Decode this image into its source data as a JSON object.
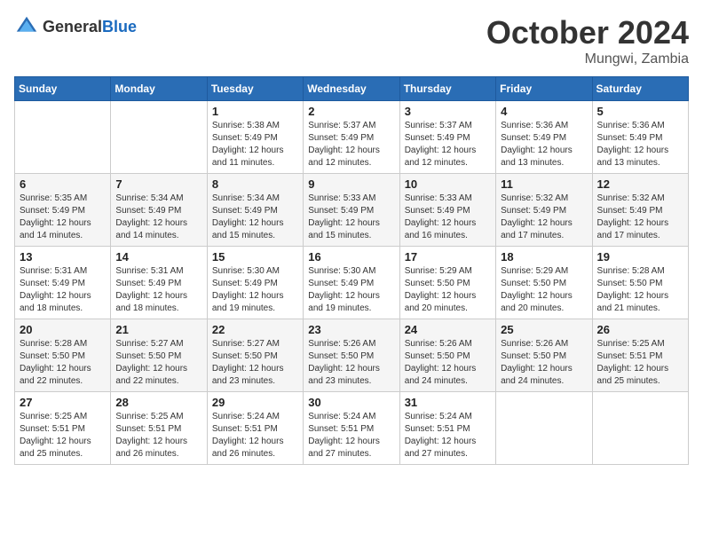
{
  "header": {
    "logo_general": "General",
    "logo_blue": "Blue",
    "month_year": "October 2024",
    "location": "Mungwi, Zambia"
  },
  "weekdays": [
    "Sunday",
    "Monday",
    "Tuesday",
    "Wednesday",
    "Thursday",
    "Friday",
    "Saturday"
  ],
  "weeks": [
    [
      {
        "day": "",
        "sunrise": "",
        "sunset": "",
        "daylight": ""
      },
      {
        "day": "",
        "sunrise": "",
        "sunset": "",
        "daylight": ""
      },
      {
        "day": "1",
        "sunrise": "Sunrise: 5:38 AM",
        "sunset": "Sunset: 5:49 PM",
        "daylight": "Daylight: 12 hours and 11 minutes."
      },
      {
        "day": "2",
        "sunrise": "Sunrise: 5:37 AM",
        "sunset": "Sunset: 5:49 PM",
        "daylight": "Daylight: 12 hours and 12 minutes."
      },
      {
        "day": "3",
        "sunrise": "Sunrise: 5:37 AM",
        "sunset": "Sunset: 5:49 PM",
        "daylight": "Daylight: 12 hours and 12 minutes."
      },
      {
        "day": "4",
        "sunrise": "Sunrise: 5:36 AM",
        "sunset": "Sunset: 5:49 PM",
        "daylight": "Daylight: 12 hours and 13 minutes."
      },
      {
        "day": "5",
        "sunrise": "Sunrise: 5:36 AM",
        "sunset": "Sunset: 5:49 PM",
        "daylight": "Daylight: 12 hours and 13 minutes."
      }
    ],
    [
      {
        "day": "6",
        "sunrise": "Sunrise: 5:35 AM",
        "sunset": "Sunset: 5:49 PM",
        "daylight": "Daylight: 12 hours and 14 minutes."
      },
      {
        "day": "7",
        "sunrise": "Sunrise: 5:34 AM",
        "sunset": "Sunset: 5:49 PM",
        "daylight": "Daylight: 12 hours and 14 minutes."
      },
      {
        "day": "8",
        "sunrise": "Sunrise: 5:34 AM",
        "sunset": "Sunset: 5:49 PM",
        "daylight": "Daylight: 12 hours and 15 minutes."
      },
      {
        "day": "9",
        "sunrise": "Sunrise: 5:33 AM",
        "sunset": "Sunset: 5:49 PM",
        "daylight": "Daylight: 12 hours and 15 minutes."
      },
      {
        "day": "10",
        "sunrise": "Sunrise: 5:33 AM",
        "sunset": "Sunset: 5:49 PM",
        "daylight": "Daylight: 12 hours and 16 minutes."
      },
      {
        "day": "11",
        "sunrise": "Sunrise: 5:32 AM",
        "sunset": "Sunset: 5:49 PM",
        "daylight": "Daylight: 12 hours and 17 minutes."
      },
      {
        "day": "12",
        "sunrise": "Sunrise: 5:32 AM",
        "sunset": "Sunset: 5:49 PM",
        "daylight": "Daylight: 12 hours and 17 minutes."
      }
    ],
    [
      {
        "day": "13",
        "sunrise": "Sunrise: 5:31 AM",
        "sunset": "Sunset: 5:49 PM",
        "daylight": "Daylight: 12 hours and 18 minutes."
      },
      {
        "day": "14",
        "sunrise": "Sunrise: 5:31 AM",
        "sunset": "Sunset: 5:49 PM",
        "daylight": "Daylight: 12 hours and 18 minutes."
      },
      {
        "day": "15",
        "sunrise": "Sunrise: 5:30 AM",
        "sunset": "Sunset: 5:49 PM",
        "daylight": "Daylight: 12 hours and 19 minutes."
      },
      {
        "day": "16",
        "sunrise": "Sunrise: 5:30 AM",
        "sunset": "Sunset: 5:49 PM",
        "daylight": "Daylight: 12 hours and 19 minutes."
      },
      {
        "day": "17",
        "sunrise": "Sunrise: 5:29 AM",
        "sunset": "Sunset: 5:50 PM",
        "daylight": "Daylight: 12 hours and 20 minutes."
      },
      {
        "day": "18",
        "sunrise": "Sunrise: 5:29 AM",
        "sunset": "Sunset: 5:50 PM",
        "daylight": "Daylight: 12 hours and 20 minutes."
      },
      {
        "day": "19",
        "sunrise": "Sunrise: 5:28 AM",
        "sunset": "Sunset: 5:50 PM",
        "daylight": "Daylight: 12 hours and 21 minutes."
      }
    ],
    [
      {
        "day": "20",
        "sunrise": "Sunrise: 5:28 AM",
        "sunset": "Sunset: 5:50 PM",
        "daylight": "Daylight: 12 hours and 22 minutes."
      },
      {
        "day": "21",
        "sunrise": "Sunrise: 5:27 AM",
        "sunset": "Sunset: 5:50 PM",
        "daylight": "Daylight: 12 hours and 22 minutes."
      },
      {
        "day": "22",
        "sunrise": "Sunrise: 5:27 AM",
        "sunset": "Sunset: 5:50 PM",
        "daylight": "Daylight: 12 hours and 23 minutes."
      },
      {
        "day": "23",
        "sunrise": "Sunrise: 5:26 AM",
        "sunset": "Sunset: 5:50 PM",
        "daylight": "Daylight: 12 hours and 23 minutes."
      },
      {
        "day": "24",
        "sunrise": "Sunrise: 5:26 AM",
        "sunset": "Sunset: 5:50 PM",
        "daylight": "Daylight: 12 hours and 24 minutes."
      },
      {
        "day": "25",
        "sunrise": "Sunrise: 5:26 AM",
        "sunset": "Sunset: 5:50 PM",
        "daylight": "Daylight: 12 hours and 24 minutes."
      },
      {
        "day": "26",
        "sunrise": "Sunrise: 5:25 AM",
        "sunset": "Sunset: 5:51 PM",
        "daylight": "Daylight: 12 hours and 25 minutes."
      }
    ],
    [
      {
        "day": "27",
        "sunrise": "Sunrise: 5:25 AM",
        "sunset": "Sunset: 5:51 PM",
        "daylight": "Daylight: 12 hours and 25 minutes."
      },
      {
        "day": "28",
        "sunrise": "Sunrise: 5:25 AM",
        "sunset": "Sunset: 5:51 PM",
        "daylight": "Daylight: 12 hours and 26 minutes."
      },
      {
        "day": "29",
        "sunrise": "Sunrise: 5:24 AM",
        "sunset": "Sunset: 5:51 PM",
        "daylight": "Daylight: 12 hours and 26 minutes."
      },
      {
        "day": "30",
        "sunrise": "Sunrise: 5:24 AM",
        "sunset": "Sunset: 5:51 PM",
        "daylight": "Daylight: 12 hours and 27 minutes."
      },
      {
        "day": "31",
        "sunrise": "Sunrise: 5:24 AM",
        "sunset": "Sunset: 5:51 PM",
        "daylight": "Daylight: 12 hours and 27 minutes."
      },
      {
        "day": "",
        "sunrise": "",
        "sunset": "",
        "daylight": ""
      },
      {
        "day": "",
        "sunrise": "",
        "sunset": "",
        "daylight": ""
      }
    ]
  ]
}
